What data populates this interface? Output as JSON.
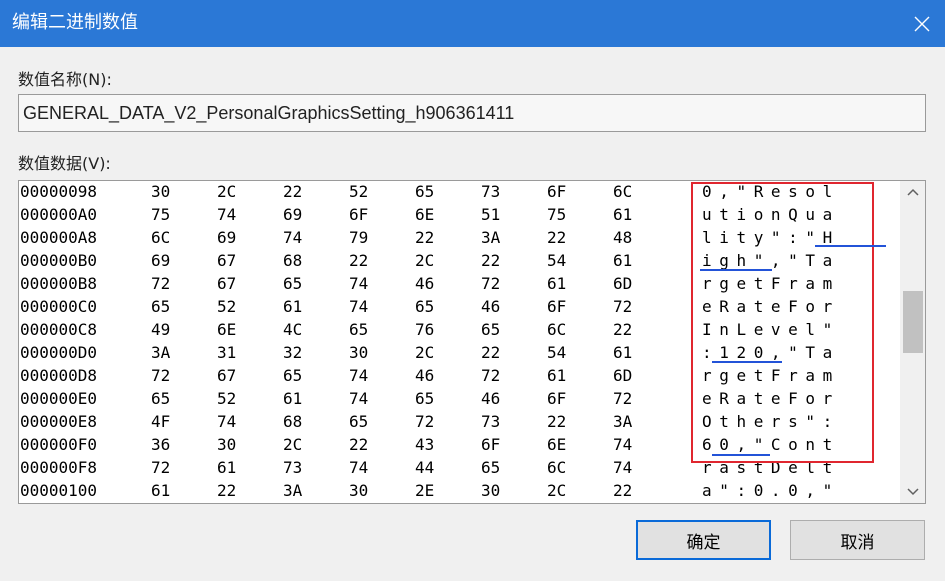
{
  "dialog": {
    "title": "编辑二进制数值",
    "name_label": "数值名称(N):",
    "name_value": "GENERAL_DATA_V2_PersonalGraphicsSetting_h906361411",
    "data_label": "数值数据(V):",
    "ok_label": "确定",
    "cancel_label": "取消",
    "accent_color": "#2b78d6",
    "highlight_color": "#e0262f"
  },
  "hex_rows": [
    {
      "addr": "00000098",
      "bytes": [
        "30",
        "2C",
        "22",
        "52",
        "65",
        "73",
        "6F",
        "6C"
      ],
      "ascii": "0,\"Resol"
    },
    {
      "addr": "000000A0",
      "bytes": [
        "75",
        "74",
        "69",
        "6F",
        "6E",
        "51",
        "75",
        "61"
      ],
      "ascii": "utionQua"
    },
    {
      "addr": "000000A8",
      "bytes": [
        "6C",
        "69",
        "74",
        "79",
        "22",
        "3A",
        "22",
        "48"
      ],
      "ascii": "lity\":\"H"
    },
    {
      "addr": "000000B0",
      "bytes": [
        "69",
        "67",
        "68",
        "22",
        "2C",
        "22",
        "54",
        "61"
      ],
      "ascii": "igh\",\"Ta"
    },
    {
      "addr": "000000B8",
      "bytes": [
        "72",
        "67",
        "65",
        "74",
        "46",
        "72",
        "61",
        "6D"
      ],
      "ascii": "rgetFram"
    },
    {
      "addr": "000000C0",
      "bytes": [
        "65",
        "52",
        "61",
        "74",
        "65",
        "46",
        "6F",
        "72"
      ],
      "ascii": "eRateFor"
    },
    {
      "addr": "000000C8",
      "bytes": [
        "49",
        "6E",
        "4C",
        "65",
        "76",
        "65",
        "6C",
        "22"
      ],
      "ascii": "InLevel\""
    },
    {
      "addr": "000000D0",
      "bytes": [
        "3A",
        "31",
        "32",
        "30",
        "2C",
        "22",
        "54",
        "61"
      ],
      "ascii": ":120,\"Ta"
    },
    {
      "addr": "000000D8",
      "bytes": [
        "72",
        "67",
        "65",
        "74",
        "46",
        "72",
        "61",
        "6D"
      ],
      "ascii": "rgetFram"
    },
    {
      "addr": "000000E0",
      "bytes": [
        "65",
        "52",
        "61",
        "74",
        "65",
        "46",
        "6F",
        "72"
      ],
      "ascii": "eRateFor"
    },
    {
      "addr": "000000E8",
      "bytes": [
        "4F",
        "74",
        "68",
        "65",
        "72",
        "73",
        "22",
        "3A"
      ],
      "ascii": "Others\":"
    },
    {
      "addr": "000000F0",
      "bytes": [
        "36",
        "30",
        "2C",
        "22",
        "43",
        "6F",
        "6E",
        "74"
      ],
      "ascii": "60,\"Cont"
    },
    {
      "addr": "000000F8",
      "bytes": [
        "72",
        "61",
        "73",
        "74",
        "44",
        "65",
        "6C",
        "74"
      ],
      "ascii": "rastDelt"
    },
    {
      "addr": "00000100",
      "bytes": [
        "61",
        "22",
        "3A",
        "30",
        "2E",
        "30",
        "2C",
        "22"
      ],
      "ascii": "a\":0.0,\""
    }
  ],
  "icons": {
    "close": "close-icon",
    "scroll_up": "chevron-up-icon",
    "scroll_down": "chevron-down-icon"
  }
}
